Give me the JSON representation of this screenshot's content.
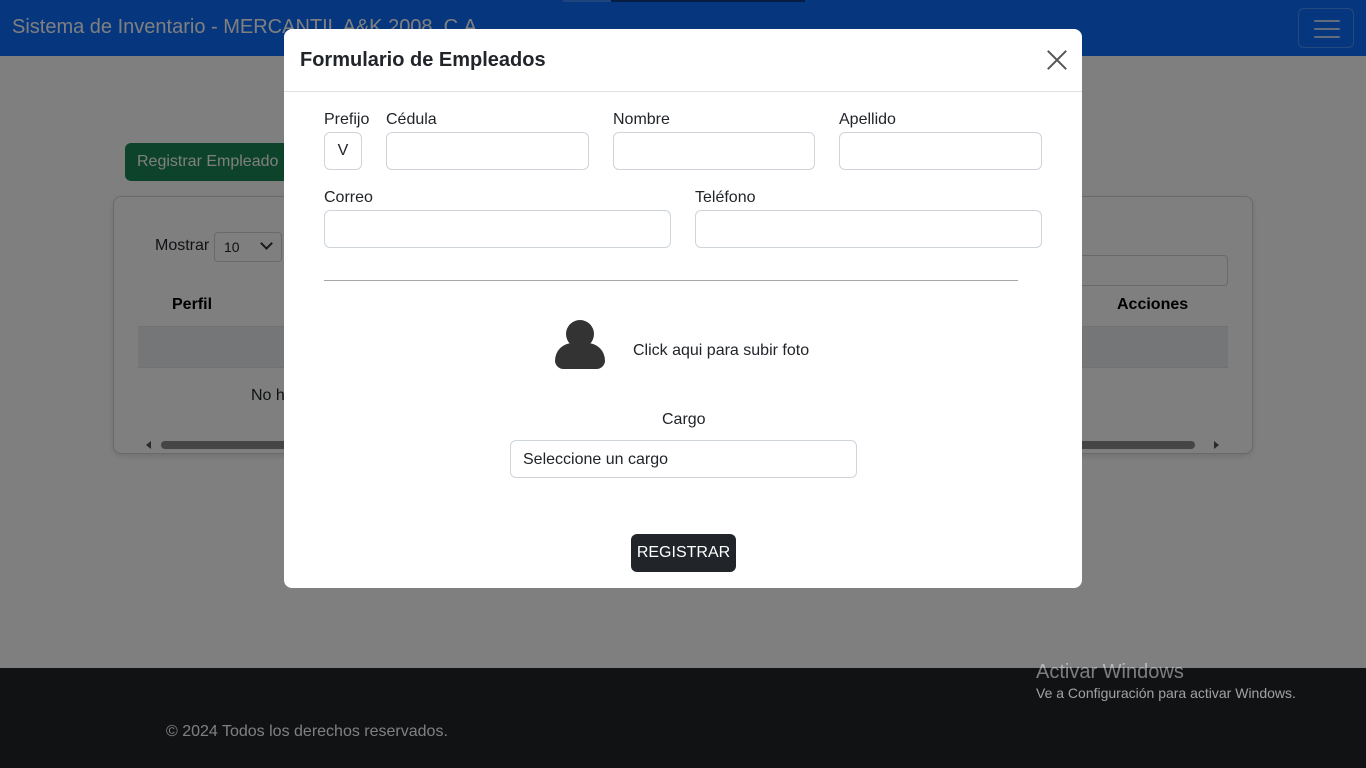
{
  "navbar": {
    "brand": "Sistema de Inventario - MERCANTIL A&K 2008, C.A"
  },
  "page": {
    "register_button": "Registrar Empleado",
    "length_label": "Mostrar",
    "length_value": "10",
    "columns": [
      "Perfil",
      "Acciones"
    ],
    "empty_message": "No h"
  },
  "footer": {
    "copyright": "© 2024 Todos los derechos reservados."
  },
  "watermark": {
    "title": "Activar Windows",
    "subtitle": "Ve a Configuración para activar Windows."
  },
  "modal": {
    "title": "Formulario de Empleados",
    "prefijo_label": "Prefijo",
    "prefijo_value": "V",
    "cedula_label": "Cédula",
    "nombre_label": "Nombre",
    "apellido_label": "Apellido",
    "correo_label": "Correo",
    "telefono_label": "Teléfono",
    "upload_text": "Click aqui para subir foto",
    "cargo_label": "Cargo",
    "cargo_placeholder": "Seleccione un cargo",
    "submit_label": "REGISTRAR"
  },
  "colors": {
    "navbar": "#0d6efd",
    "success": "#198754",
    "dark": "#212529"
  },
  "icons": [
    "close-icon",
    "user-avatar-icon",
    "chevron-down-icon",
    "hamburger-icon"
  ]
}
